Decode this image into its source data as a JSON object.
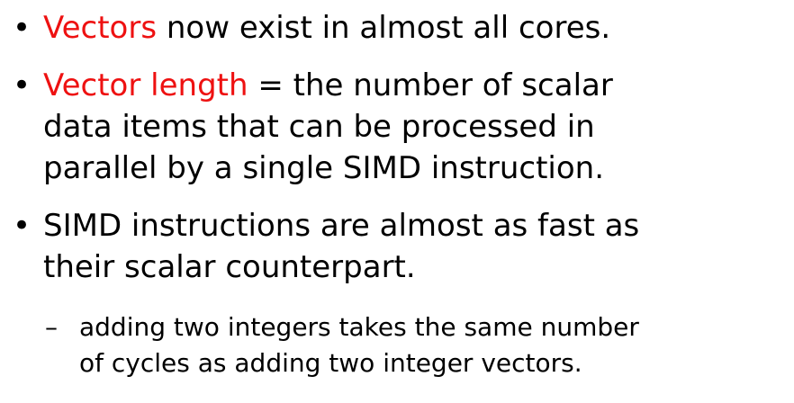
{
  "bullets": [
    {
      "marker": "•",
      "highlight": "Vectors",
      "lines": [
        " now exist in almost all cores."
      ]
    },
    {
      "marker": "•",
      "highlight": "Vector length",
      "lines": [
        " = the number of scalar",
        "data items that can be processed in",
        "parallel by a single SIMD instruction."
      ]
    },
    {
      "marker": "•",
      "lines": [
        "SIMD instructions are almost as fast as",
        "their scalar counterpart."
      ]
    }
  ],
  "subbullets": [
    {
      "marker": "–",
      "lines": [
        "adding two integers takes the same number",
        "of cycles as adding two integer vectors."
      ]
    }
  ],
  "colors": {
    "highlight": "#ee1111",
    "text": "#000000",
    "background": "#ffffff"
  }
}
